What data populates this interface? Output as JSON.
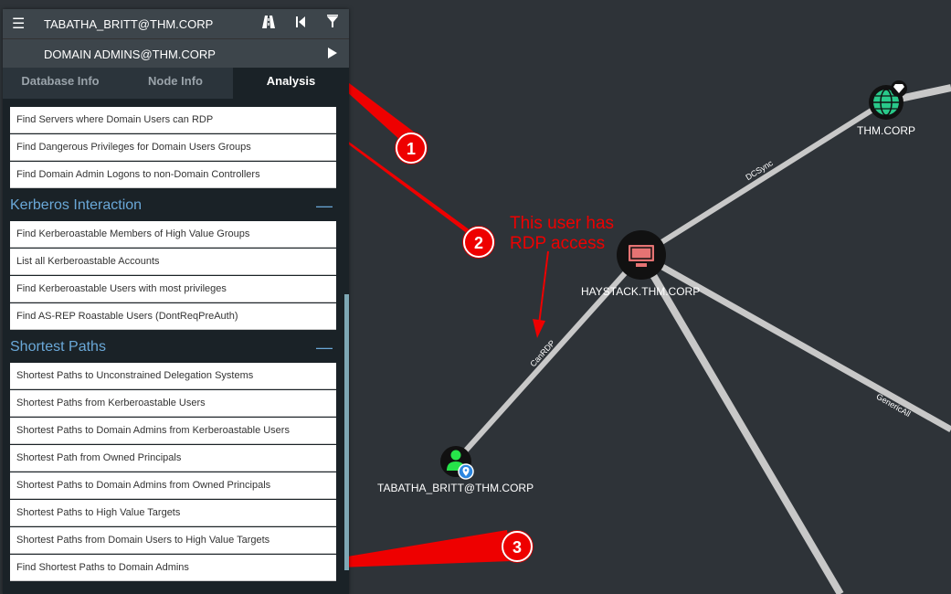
{
  "search": {
    "start_node": "TABATHA_BRITT@THM.CORP",
    "end_node": "DOMAIN ADMINS@THM.CORP"
  },
  "toolbar": {
    "menu_icon": "hamburger-icon",
    "path_icon": "road-icon",
    "back_icon": "skip-back-icon",
    "filter_icon": "filter-icon",
    "play_icon": "play-icon"
  },
  "tabs": [
    {
      "label": "Database Info",
      "active": false
    },
    {
      "label": "Node Info",
      "active": false
    },
    {
      "label": "Analysis",
      "active": true
    }
  ],
  "queries_top": [
    "Find Servers where Domain Users can RDP",
    "Find Dangerous Privileges for Domain Users Groups",
    "Find Domain Admin Logons to non-Domain Controllers"
  ],
  "sections": [
    {
      "title": "Kerberos Interaction",
      "collapse_label": "—",
      "items": [
        "Find Kerberoastable Members of High Value Groups",
        "List all Kerberoastable Accounts",
        "Find Kerberoastable Users with most privileges",
        "Find AS-REP Roastable Users (DontReqPreAuth)"
      ]
    },
    {
      "title": "Shortest Paths",
      "collapse_label": "—",
      "items": [
        "Shortest Paths to Unconstrained Delegation Systems",
        "Shortest Paths from Kerberoastable Users",
        "Shortest Paths to Domain Admins from Kerberoastable Users",
        "Shortest Path from Owned Principals",
        "Shortest Paths to Domain Admins from Owned Principals",
        "Shortest Paths to High Value Targets",
        "Shortest Paths from Domain Users to High Value Targets",
        "Find Shortest Paths to Domain Admins"
      ]
    }
  ],
  "graph": {
    "nodes": {
      "domain": "THM.CORP",
      "computer": "HAYSTACK.THM.CORP",
      "user": "TABATHA_BRITT@THM.CORP"
    },
    "edges": {
      "dcsync": "DCSync",
      "canrdp": "CanRDP",
      "genericall": "GenericAll"
    }
  },
  "annotations": {
    "note_line1": "This user has",
    "note_line2": "RDP access",
    "markers": [
      "1",
      "2",
      "3"
    ],
    "color": "#e00000"
  }
}
